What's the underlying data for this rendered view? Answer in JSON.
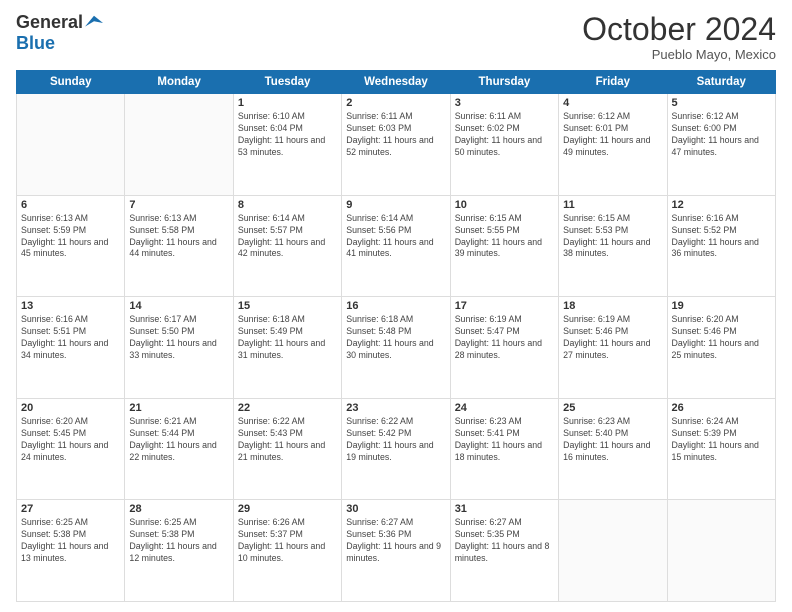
{
  "header": {
    "logo_general": "General",
    "logo_blue": "Blue",
    "month_title": "October 2024",
    "subtitle": "Pueblo Mayo, Mexico"
  },
  "days_of_week": [
    "Sunday",
    "Monday",
    "Tuesday",
    "Wednesday",
    "Thursday",
    "Friday",
    "Saturday"
  ],
  "weeks": [
    [
      {
        "day": "",
        "info": ""
      },
      {
        "day": "",
        "info": ""
      },
      {
        "day": "1",
        "info": "Sunrise: 6:10 AM\nSunset: 6:04 PM\nDaylight: 11 hours and 53 minutes."
      },
      {
        "day": "2",
        "info": "Sunrise: 6:11 AM\nSunset: 6:03 PM\nDaylight: 11 hours and 52 minutes."
      },
      {
        "day": "3",
        "info": "Sunrise: 6:11 AM\nSunset: 6:02 PM\nDaylight: 11 hours and 50 minutes."
      },
      {
        "day": "4",
        "info": "Sunrise: 6:12 AM\nSunset: 6:01 PM\nDaylight: 11 hours and 49 minutes."
      },
      {
        "day": "5",
        "info": "Sunrise: 6:12 AM\nSunset: 6:00 PM\nDaylight: 11 hours and 47 minutes."
      }
    ],
    [
      {
        "day": "6",
        "info": "Sunrise: 6:13 AM\nSunset: 5:59 PM\nDaylight: 11 hours and 45 minutes."
      },
      {
        "day": "7",
        "info": "Sunrise: 6:13 AM\nSunset: 5:58 PM\nDaylight: 11 hours and 44 minutes."
      },
      {
        "day": "8",
        "info": "Sunrise: 6:14 AM\nSunset: 5:57 PM\nDaylight: 11 hours and 42 minutes."
      },
      {
        "day": "9",
        "info": "Sunrise: 6:14 AM\nSunset: 5:56 PM\nDaylight: 11 hours and 41 minutes."
      },
      {
        "day": "10",
        "info": "Sunrise: 6:15 AM\nSunset: 5:55 PM\nDaylight: 11 hours and 39 minutes."
      },
      {
        "day": "11",
        "info": "Sunrise: 6:15 AM\nSunset: 5:53 PM\nDaylight: 11 hours and 38 minutes."
      },
      {
        "day": "12",
        "info": "Sunrise: 6:16 AM\nSunset: 5:52 PM\nDaylight: 11 hours and 36 minutes."
      }
    ],
    [
      {
        "day": "13",
        "info": "Sunrise: 6:16 AM\nSunset: 5:51 PM\nDaylight: 11 hours and 34 minutes."
      },
      {
        "day": "14",
        "info": "Sunrise: 6:17 AM\nSunset: 5:50 PM\nDaylight: 11 hours and 33 minutes."
      },
      {
        "day": "15",
        "info": "Sunrise: 6:18 AM\nSunset: 5:49 PM\nDaylight: 11 hours and 31 minutes."
      },
      {
        "day": "16",
        "info": "Sunrise: 6:18 AM\nSunset: 5:48 PM\nDaylight: 11 hours and 30 minutes."
      },
      {
        "day": "17",
        "info": "Sunrise: 6:19 AM\nSunset: 5:47 PM\nDaylight: 11 hours and 28 minutes."
      },
      {
        "day": "18",
        "info": "Sunrise: 6:19 AM\nSunset: 5:46 PM\nDaylight: 11 hours and 27 minutes."
      },
      {
        "day": "19",
        "info": "Sunrise: 6:20 AM\nSunset: 5:46 PM\nDaylight: 11 hours and 25 minutes."
      }
    ],
    [
      {
        "day": "20",
        "info": "Sunrise: 6:20 AM\nSunset: 5:45 PM\nDaylight: 11 hours and 24 minutes."
      },
      {
        "day": "21",
        "info": "Sunrise: 6:21 AM\nSunset: 5:44 PM\nDaylight: 11 hours and 22 minutes."
      },
      {
        "day": "22",
        "info": "Sunrise: 6:22 AM\nSunset: 5:43 PM\nDaylight: 11 hours and 21 minutes."
      },
      {
        "day": "23",
        "info": "Sunrise: 6:22 AM\nSunset: 5:42 PM\nDaylight: 11 hours and 19 minutes."
      },
      {
        "day": "24",
        "info": "Sunrise: 6:23 AM\nSunset: 5:41 PM\nDaylight: 11 hours and 18 minutes."
      },
      {
        "day": "25",
        "info": "Sunrise: 6:23 AM\nSunset: 5:40 PM\nDaylight: 11 hours and 16 minutes."
      },
      {
        "day": "26",
        "info": "Sunrise: 6:24 AM\nSunset: 5:39 PM\nDaylight: 11 hours and 15 minutes."
      }
    ],
    [
      {
        "day": "27",
        "info": "Sunrise: 6:25 AM\nSunset: 5:38 PM\nDaylight: 11 hours and 13 minutes."
      },
      {
        "day": "28",
        "info": "Sunrise: 6:25 AM\nSunset: 5:38 PM\nDaylight: 11 hours and 12 minutes."
      },
      {
        "day": "29",
        "info": "Sunrise: 6:26 AM\nSunset: 5:37 PM\nDaylight: 11 hours and 10 minutes."
      },
      {
        "day": "30",
        "info": "Sunrise: 6:27 AM\nSunset: 5:36 PM\nDaylight: 11 hours and 9 minutes."
      },
      {
        "day": "31",
        "info": "Sunrise: 6:27 AM\nSunset: 5:35 PM\nDaylight: 11 hours and 8 minutes."
      },
      {
        "day": "",
        "info": ""
      },
      {
        "day": "",
        "info": ""
      }
    ]
  ]
}
